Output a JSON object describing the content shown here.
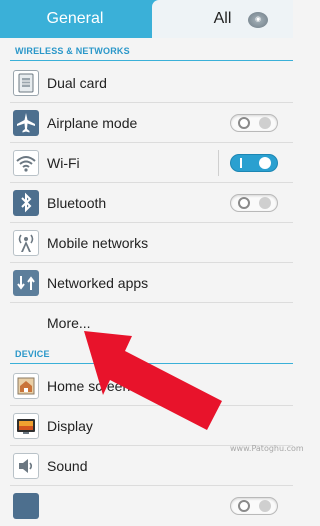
{
  "tabs": {
    "general": "General",
    "all": "All"
  },
  "sections": {
    "wireless": "WIRELESS & NETWORKS",
    "device": "DEVICE"
  },
  "items": {
    "dual_card": {
      "label": "Dual card",
      "icon": "sim-card-icon"
    },
    "airplane": {
      "label": "Airplane mode",
      "icon": "airplane-icon",
      "toggle": "off"
    },
    "wifi": {
      "label": "Wi-Fi",
      "icon": "wifi-icon",
      "toggle": "on"
    },
    "bluetooth": {
      "label": "Bluetooth",
      "icon": "bluetooth-icon",
      "toggle": "off"
    },
    "mobile_networks": {
      "label": "Mobile networks",
      "icon": "antenna-icon"
    },
    "networked_apps": {
      "label": "Networked apps",
      "icon": "network-apps-icon"
    },
    "more": {
      "label": "More..."
    },
    "home_screen": {
      "label": "Home screen sty",
      "icon": "home-icon"
    },
    "display": {
      "label": "Display",
      "icon": "display-icon"
    },
    "sound": {
      "label": "Sound",
      "icon": "speaker-icon"
    }
  },
  "watermark": {
    "text": "www.Patoghu.com"
  },
  "colors": {
    "accent": "#3ab0d8",
    "toggle_on": "#2aa0d0",
    "arrow": "#e8132b"
  }
}
